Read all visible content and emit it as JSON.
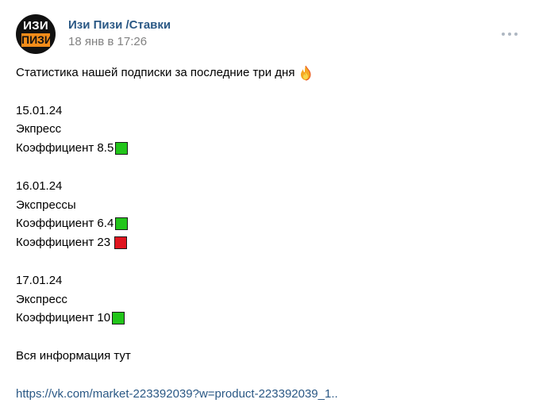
{
  "post": {
    "avatar": {
      "top_text": "ИЗИ",
      "bottom_text": "ПИЗИ"
    },
    "author": "Изи Пизи /Ставки",
    "date": "18 янв в 17:26",
    "more_icon": "more-horizontal-icon",
    "intro": "Статистика нашей подписки за последние три дня",
    "intro_icon": "fire-icon",
    "days": [
      {
        "date": "15.01.24",
        "type": "Экпресс",
        "coefficients": [
          {
            "text": "Коэффициент 8.5",
            "result": "win",
            "icon": "green-square-icon"
          }
        ]
      },
      {
        "date": "16.01.24",
        "type": "Экспрессы",
        "coefficients": [
          {
            "text": "Коэффициент 6.4",
            "result": "win",
            "icon": "green-square-icon"
          },
          {
            "text": "Коэффициент 23",
            "result": "loss",
            "icon": "red-square-icon"
          }
        ]
      },
      {
        "date": "17.01.24",
        "type": "Экспресс",
        "coefficients": [
          {
            "text": "Коэффициент 10",
            "result": "win",
            "icon": "green-square-icon"
          }
        ]
      }
    ],
    "info_text": "Вся информация тут",
    "link_text": "https://vk.com/market-223392039?w=product-223392039_1.."
  },
  "colors": {
    "link": "#2a5885",
    "meta": "#828282",
    "win": "#22c51a",
    "loss": "#e0151f",
    "avatar_accent": "#f28c1a"
  }
}
